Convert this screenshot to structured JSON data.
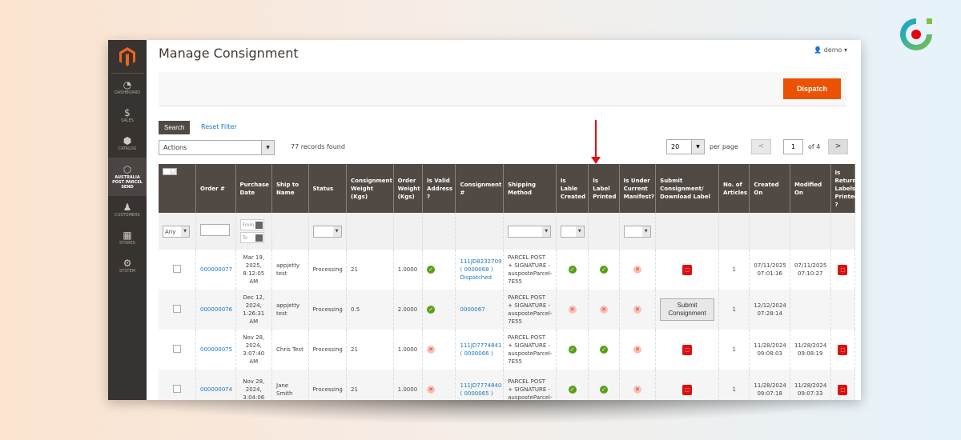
{
  "brand": {
    "accent": "#eb5202"
  },
  "sidebar": {
    "items": [
      {
        "label": "DASHBOARD",
        "icon": "dashboard-icon",
        "glyph": "◔"
      },
      {
        "label": "SALES",
        "icon": "dollar-icon",
        "glyph": "$"
      },
      {
        "label": "CATALOG",
        "icon": "box-icon",
        "glyph": "⬢"
      },
      {
        "label": "AUSTRALIA POST PARCEL SEND",
        "icon": "hexagon-icon",
        "glyph": "⬡"
      },
      {
        "label": "CUSTOMERS",
        "icon": "person-icon",
        "glyph": "♟"
      },
      {
        "label": "STORES",
        "icon": "store-icon",
        "glyph": "▦"
      },
      {
        "label": "SYSTEM",
        "icon": "gear-icon",
        "glyph": "⚙"
      }
    ]
  },
  "header": {
    "title": "Manage Consignment",
    "user": "demo"
  },
  "toolbar": {
    "dispatch": "Dispatch",
    "search": "Search",
    "reset": "Reset Filter",
    "actions": "Actions",
    "records": "77 records found",
    "per_page_value": "20",
    "per_page_label": "per page",
    "page": "1",
    "of": "of 4",
    "prev": "<",
    "next": ">"
  },
  "table": {
    "headers": [
      "",
      "Order #",
      "Purchase Date",
      "Ship to Name",
      "Status",
      "Consignment Weight (Kgs)",
      "Order Weight (Kgs)",
      "Is Valid Address ?",
      "Consignment #",
      "Shipping Method",
      "Is Lable Created",
      "Is Label Printed",
      "Is Under Current Manifest?",
      "Submit Consignment/ Download Label",
      "No. of Articles",
      "Created On",
      "Modified On",
      "Is Return Labels Printed ?"
    ],
    "filter": {
      "any": "Any",
      "from": "From",
      "to": "To"
    },
    "rows": [
      {
        "order": "000000077",
        "date": "Mar 19, 2025, 8:12:05 AM",
        "name": "appjetty test",
        "status": "Processing",
        "cweight": "21",
        "oweight": "1.0000",
        "valid": true,
        "consignment": "111JD8232709 ( 0000068 ) Dispatched",
        "method": "PARCEL POST + SIGNATURE - ausposteParcel-7E55",
        "label_created": true,
        "label_printed": true,
        "manifest": false,
        "submit": "pdf",
        "articles": "1",
        "created": "07/11/2025 07:01:16",
        "modified": "07/11/2025 07:10:27",
        "return_pdf": true
      },
      {
        "order": "000000076",
        "date": "Dec 12, 2024, 1:26:31 AM",
        "name": "appjetty test",
        "status": "Processing",
        "cweight": "0.5",
        "oweight": "2.0000",
        "valid": true,
        "consignment": "0000067",
        "method": "PARCEL POST + SIGNATURE - ausposteParcel-7E55",
        "label_created": false,
        "label_printed": false,
        "manifest": false,
        "submit": "Submit Consignment",
        "articles": "1",
        "created": "12/12/2024 07:28:14",
        "modified": "",
        "return_pdf": false
      },
      {
        "order": "000000075",
        "date": "Nov 28, 2024, 3:07:40 AM",
        "name": "Chris Test",
        "status": "Processing",
        "cweight": "21",
        "oweight": "1.0000",
        "valid": false,
        "consignment": "111JD7774841 ( 0000066 )",
        "method": "PARCEL POST + SIGNATURE - ausposteParcel-7E55",
        "label_created": true,
        "label_printed": true,
        "manifest": false,
        "submit": "pdf",
        "articles": "1",
        "created": "11/28/2024 09:08:03",
        "modified": "11/28/2024 09:08:19",
        "return_pdf": true
      },
      {
        "order": "000000074",
        "date": "Nov 28, 2024, 3:04:06",
        "name": "Jane Smith",
        "status": "Processing",
        "cweight": "21",
        "oweight": "1.0000",
        "valid": false,
        "consignment": "111JD7774840 ( 0000065 )",
        "method": "PARCEL POST + SIGNATURE - ausposteParcel-",
        "label_created": true,
        "label_printed": true,
        "manifest": false,
        "submit": "pdf",
        "articles": "1",
        "created": "11/28/2024 09:07:18",
        "modified": "11/28/2024 09:07:33",
        "return_pdf": true
      }
    ]
  }
}
